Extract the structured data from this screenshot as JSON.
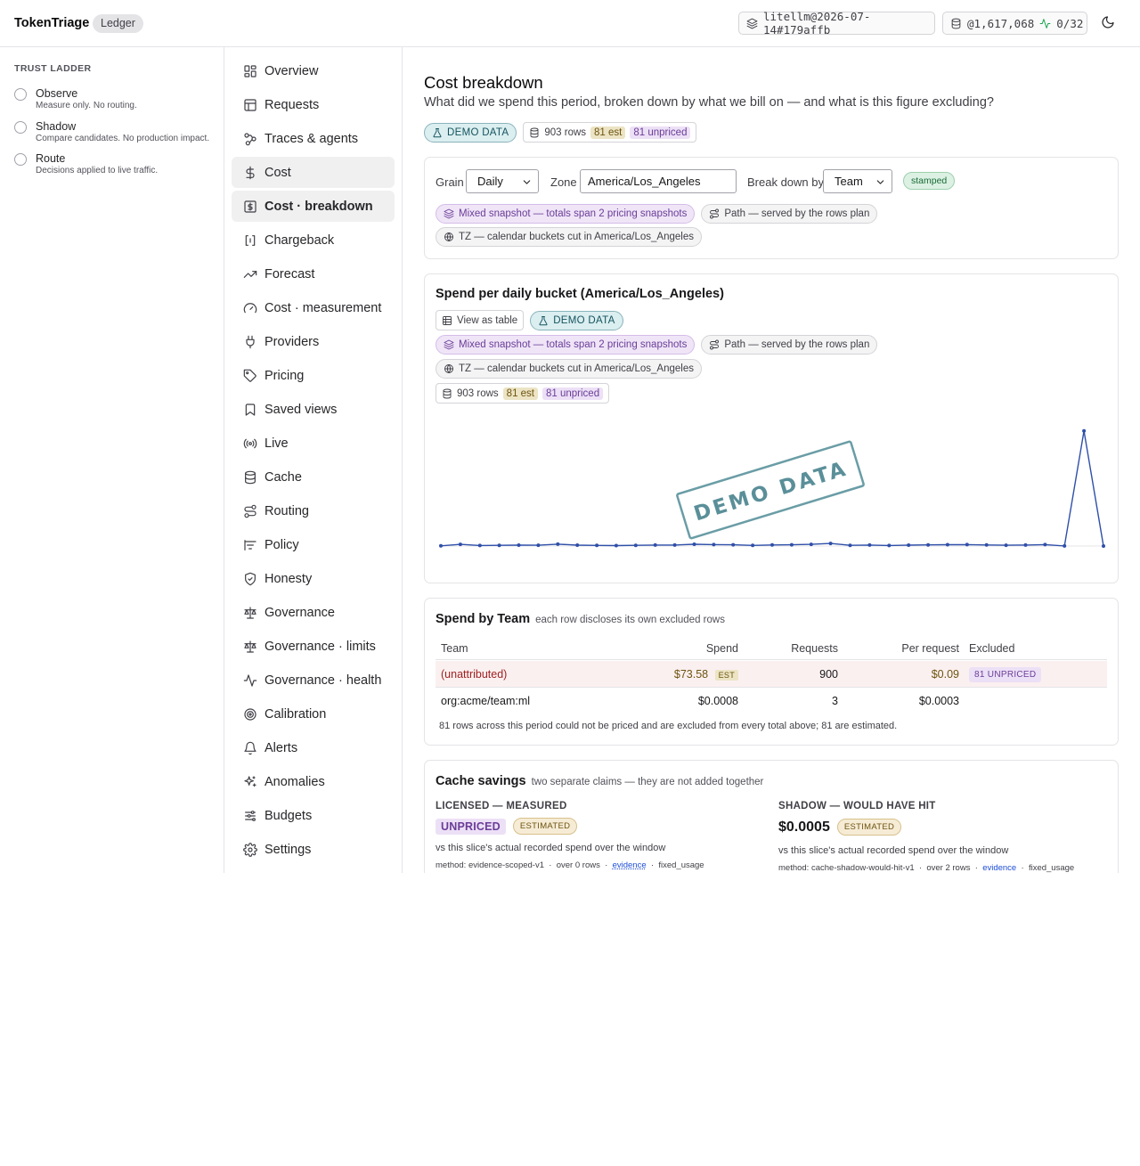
{
  "header": {
    "brand": "TokenTriage",
    "section_pill": "Ledger",
    "snapshot": "litellm@2026-07-14#179affb",
    "row_count": "@1,617,068",
    "live_ratio": "0/32"
  },
  "trust_ladder": {
    "title": "TRUST LADDER",
    "items": [
      {
        "name": "Observe",
        "desc": "Measure only. No routing."
      },
      {
        "name": "Shadow",
        "desc": "Compare candidates. No production impact."
      },
      {
        "name": "Route",
        "desc": "Decisions applied to live traffic."
      }
    ]
  },
  "nav": {
    "items": [
      {
        "label": "Overview",
        "icon": "grid-icon"
      },
      {
        "label": "Requests",
        "icon": "table-icon"
      },
      {
        "label": "Traces & agents",
        "icon": "workflow-icon"
      },
      {
        "label": "Cost",
        "icon": "dollar-icon"
      },
      {
        "label": "Cost · breakdown",
        "icon": "dollar-box-icon"
      },
      {
        "label": "Chargeback",
        "icon": "bracket-icon"
      },
      {
        "label": "Forecast",
        "icon": "trend-up-icon"
      },
      {
        "label": "Cost · measurement",
        "icon": "gauge-icon"
      },
      {
        "label": "Providers",
        "icon": "plug-icon"
      },
      {
        "label": "Pricing",
        "icon": "tag-icon"
      },
      {
        "label": "Saved views",
        "icon": "bookmark-icon"
      },
      {
        "label": "Live",
        "icon": "radio-icon"
      },
      {
        "label": "Cache",
        "icon": "database-icon"
      },
      {
        "label": "Routing",
        "icon": "route-icon"
      },
      {
        "label": "Policy",
        "icon": "list-filter-icon"
      },
      {
        "label": "Honesty",
        "icon": "shield-check-icon"
      },
      {
        "label": "Governance",
        "icon": "scale-icon"
      },
      {
        "label": "Governance · limits",
        "icon": "scale-icon"
      },
      {
        "label": "Governance · health",
        "icon": "activity-icon"
      },
      {
        "label": "Calibration",
        "icon": "target-icon"
      },
      {
        "label": "Alerts",
        "icon": "bell-icon"
      },
      {
        "label": "Anomalies",
        "icon": "sparkles-icon"
      },
      {
        "label": "Budgets",
        "icon": "sliders-icon"
      },
      {
        "label": "Settings",
        "icon": "gear-icon"
      }
    ]
  },
  "page": {
    "title": "Cost breakdown",
    "subtitle": "What did we spend this period, broken down by what we bill on — and what is this figure excluding?",
    "demo_label": "DEMO DATA",
    "rows_label": "903 rows",
    "est_label": "81 est",
    "unpriced_label": "81 unpriced"
  },
  "controls": {
    "grain_label": "Grain",
    "grain_value": "Daily",
    "zone_label": "Zone",
    "zone_value": "America/Los_Angeles",
    "breakdown_label": "Break down by",
    "breakdown_value": "Team",
    "stamped_label": "stamped",
    "mixed_label": "Mixed snapshot — totals span 2 pricing snapshots",
    "path_label": "Path — served by the rows plan",
    "tz_label": "TZ — calendar buckets cut in America/Los_Angeles"
  },
  "chart_card": {
    "title": "Spend per daily bucket (America/Los_Angeles)",
    "view_table_label": "View as table",
    "watermark": "DEMO DATA"
  },
  "chart_data": {
    "type": "line",
    "title": "Spend per daily bucket (America/Los_Angeles)",
    "xlabel": "",
    "ylabel": "",
    "grid": false,
    "x_ticks_shown": false,
    "y_ticks_shown": false,
    "values": [
      0.12,
      1.08,
      0.32,
      0.45,
      0.58,
      0.5,
      1.18,
      0.58,
      0.38,
      0.3,
      0.46,
      0.62,
      0.6,
      1.12,
      0.9,
      0.82,
      0.38,
      0.7,
      0.78,
      1.1,
      1.66,
      0.48,
      0.6,
      0.36,
      0.54,
      0.72,
      0.88,
      0.9,
      0.68,
      0.5,
      0.64,
      0.92,
      0.06,
      73.4,
      0.0
    ],
    "ylim": [
      0,
      75
    ]
  },
  "team_card": {
    "title": "Spend by Team",
    "note": "each row discloses its own excluded rows",
    "columns": {
      "team": "Team",
      "spend": "Spend",
      "requests": "Requests",
      "per_request": "Per request",
      "excluded": "Excluded"
    },
    "rows": [
      {
        "team": "(unattributed)",
        "spend": "$73.58",
        "spend_flag": "EST",
        "requests": "900",
        "per_request": "$0.09",
        "excluded": "81 UNPRICED"
      },
      {
        "team": "org:acme/team:ml",
        "spend": "$0.0008",
        "requests": "3",
        "per_request": "$0.0003",
        "excluded": ""
      }
    ],
    "footnote": "81 rows across this period could not be priced and are excluded from every total above; 81 are estimated."
  },
  "cache_card": {
    "title": "Cache savings",
    "note": "two separate claims — they are not added together",
    "left": {
      "label": "LICENSED — MEASURED",
      "value": "UNPRICED",
      "badge": "ESTIMATED",
      "desc": "vs this slice's actual recorded spend over the window",
      "method": "method: evidence-scoped-v1",
      "rows": "over 0 rows",
      "evidence": "evidence",
      "usage": "fixed_usage"
    },
    "right": {
      "label": "SHADOW — WOULD HAVE HIT",
      "value": "$0.0005",
      "badge": "ESTIMATED",
      "desc": "vs this slice's actual recorded spend over the window",
      "method": "method: cache-shadow-would-hit-v1",
      "rows": "over 2 rows",
      "evidence": "evidence",
      "usage": "fixed_usage"
    }
  }
}
